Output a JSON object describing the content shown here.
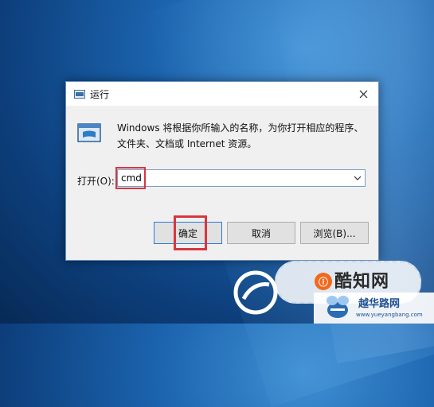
{
  "dialog": {
    "title": "运行",
    "description_line1": "Windows 将根据你所输入的名称，为你打开相应的程序、",
    "description_line2": "文件夹、文档或 Internet 资源。",
    "open_label": "打开(O):",
    "command_value": "cmd",
    "ok_label": "确定",
    "cancel_label": "取消",
    "browse_label": "浏览(B)..."
  },
  "watermark": {
    "site_name": "酷知网",
    "site_badge": "ⓘ",
    "site2_name": "越华路网",
    "site2_url": "www.yueyangbang.com"
  },
  "colors": {
    "highlight": "#d9363e",
    "desktop": "#1b63ad"
  }
}
